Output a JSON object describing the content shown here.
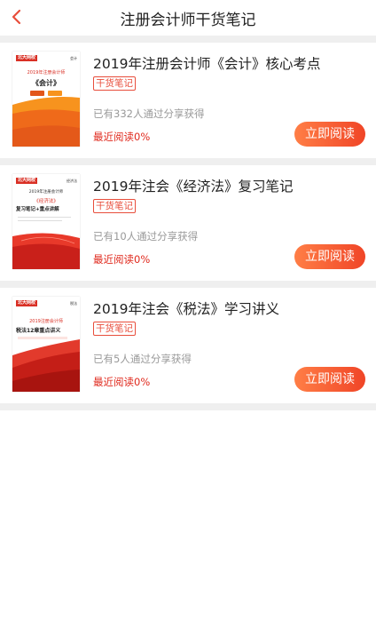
{
  "header": {
    "title": "注册会计师干货笔记",
    "back_icon": "chevron-left-icon",
    "accent": "#e84e3c"
  },
  "items": [
    {
      "title": "2019年注册会计师《会计》核心考点",
      "badge": "干货笔记",
      "shared": "已有332人通过分享获得",
      "recent": "最近阅读0%",
      "button": "立即阅读",
      "cover": {
        "brand": "北大网校",
        "tag": "会计",
        "lines": [
          "2019年注册会计师",
          "《会计》"
        ]
      }
    },
    {
      "title": "2019年注会《经济法》复习笔记",
      "badge": "干货笔记",
      "shared": "已有10人通过分享获得",
      "recent": "最近阅读0%",
      "button": "立即阅读",
      "cover": {
        "brand": "北大网校",
        "tag": "经济法",
        "lines": [
          "2019年注册会计师",
          "《经济法》",
          "复习笔记+重点讲解"
        ]
      }
    },
    {
      "title": "2019年注会《税法》学习讲义",
      "badge": "干货笔记",
      "shared": "已有5人通过分享获得",
      "recent": "最近阅读0%",
      "button": "立即阅读",
      "cover": {
        "brand": "北大网校",
        "tag": "税法",
        "lines": [
          "2019注册会计师",
          "税法12章重点讲义"
        ]
      }
    }
  ]
}
